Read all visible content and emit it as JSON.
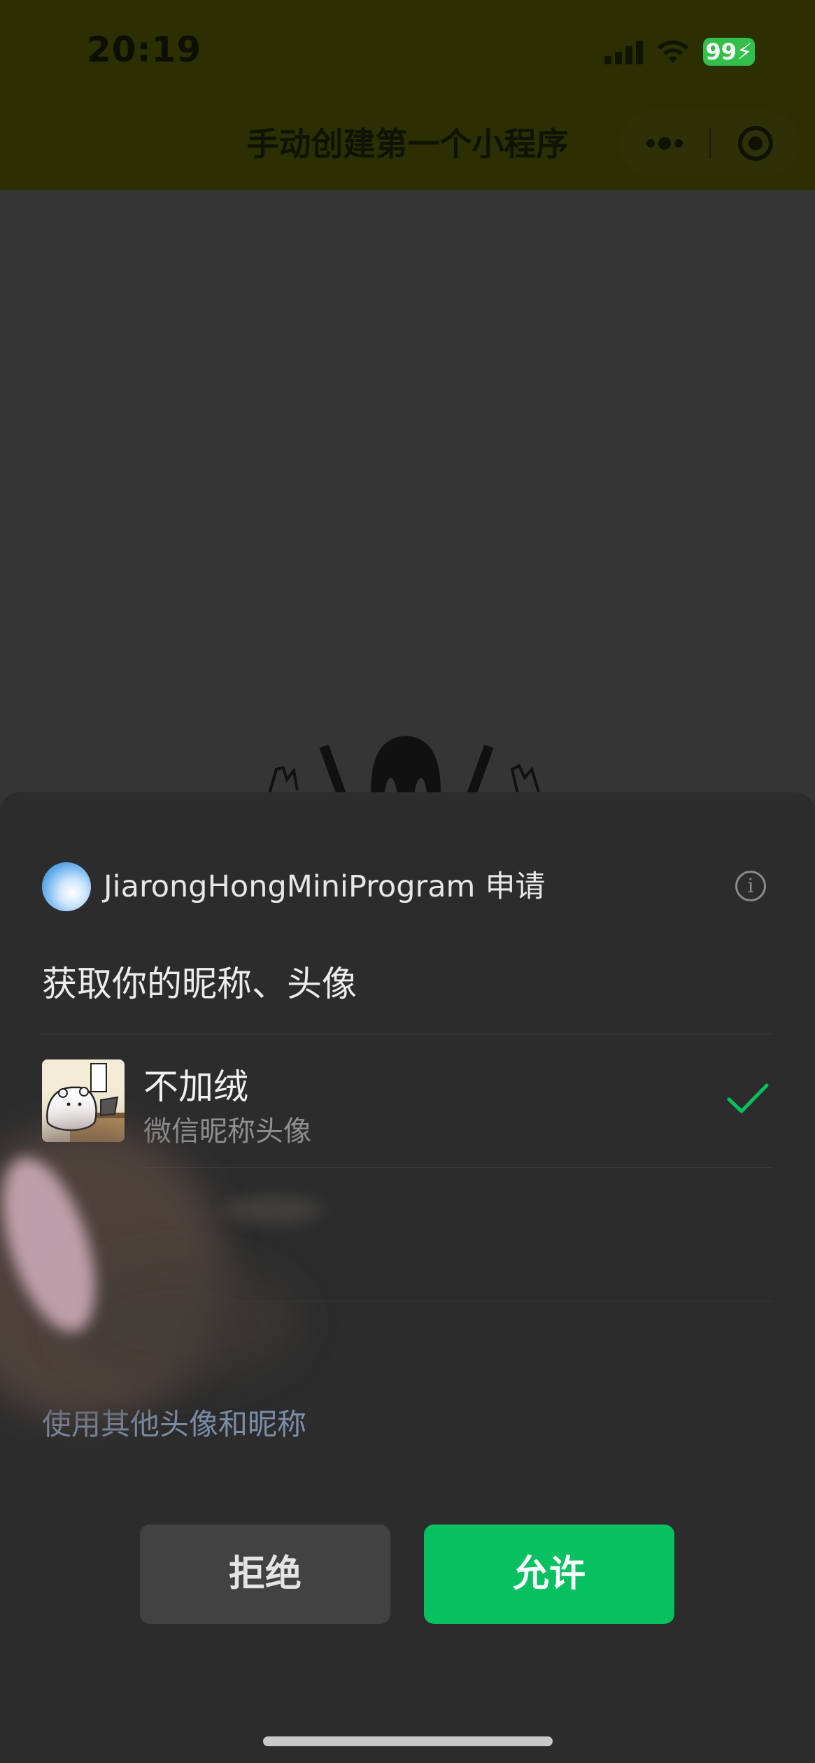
{
  "status_bar": {
    "time": "20:19",
    "battery": "99",
    "icons": [
      "signal-icon",
      "wifi-icon",
      "battery-charging-icon"
    ]
  },
  "nav_bar": {
    "title": "手动创建第一个小程序",
    "icons": [
      "more-dots-icon",
      "close-target-icon"
    ]
  },
  "sheet": {
    "app_name": "JiarongHongMiniProgram",
    "request_word": "申请",
    "request_title": "获取你的昵称、头像",
    "profile": {
      "nickname": "不加绒",
      "source": "微信昵称头像",
      "selected": true
    },
    "other_option": "使用其他头像和昵称",
    "buttons": {
      "reject": "拒绝",
      "allow": "允许"
    }
  },
  "colors": {
    "accent_green": "#07c160",
    "sheet_bg": "#2c2c2c",
    "header_bg": "#2b2f02"
  }
}
